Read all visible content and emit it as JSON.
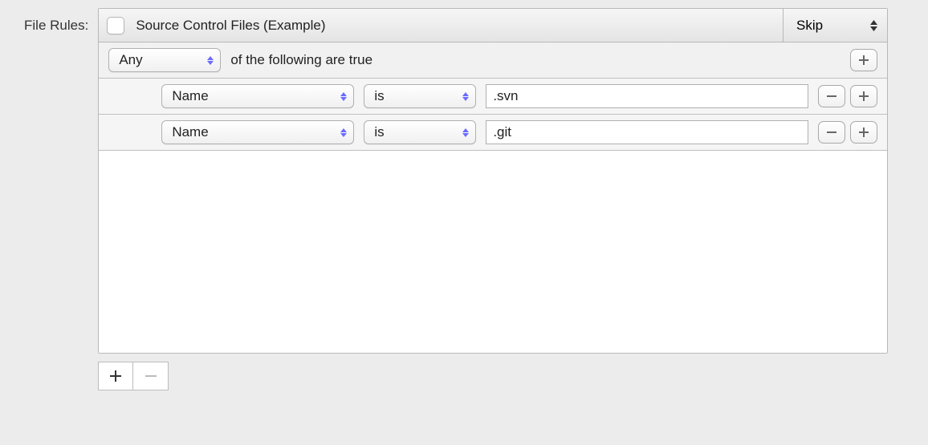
{
  "label": "File Rules:",
  "header": {
    "title": "Source Control Files (Example)",
    "action": "Skip",
    "checked": false
  },
  "group": {
    "match": "Any",
    "suffix_text": "of the following are true"
  },
  "rules": [
    {
      "attribute": "Name",
      "operator": "is",
      "value": ".svn"
    },
    {
      "attribute": "Name",
      "operator": "is",
      "value": ".git"
    }
  ],
  "icons": {
    "plus": "+",
    "minus": "−"
  }
}
